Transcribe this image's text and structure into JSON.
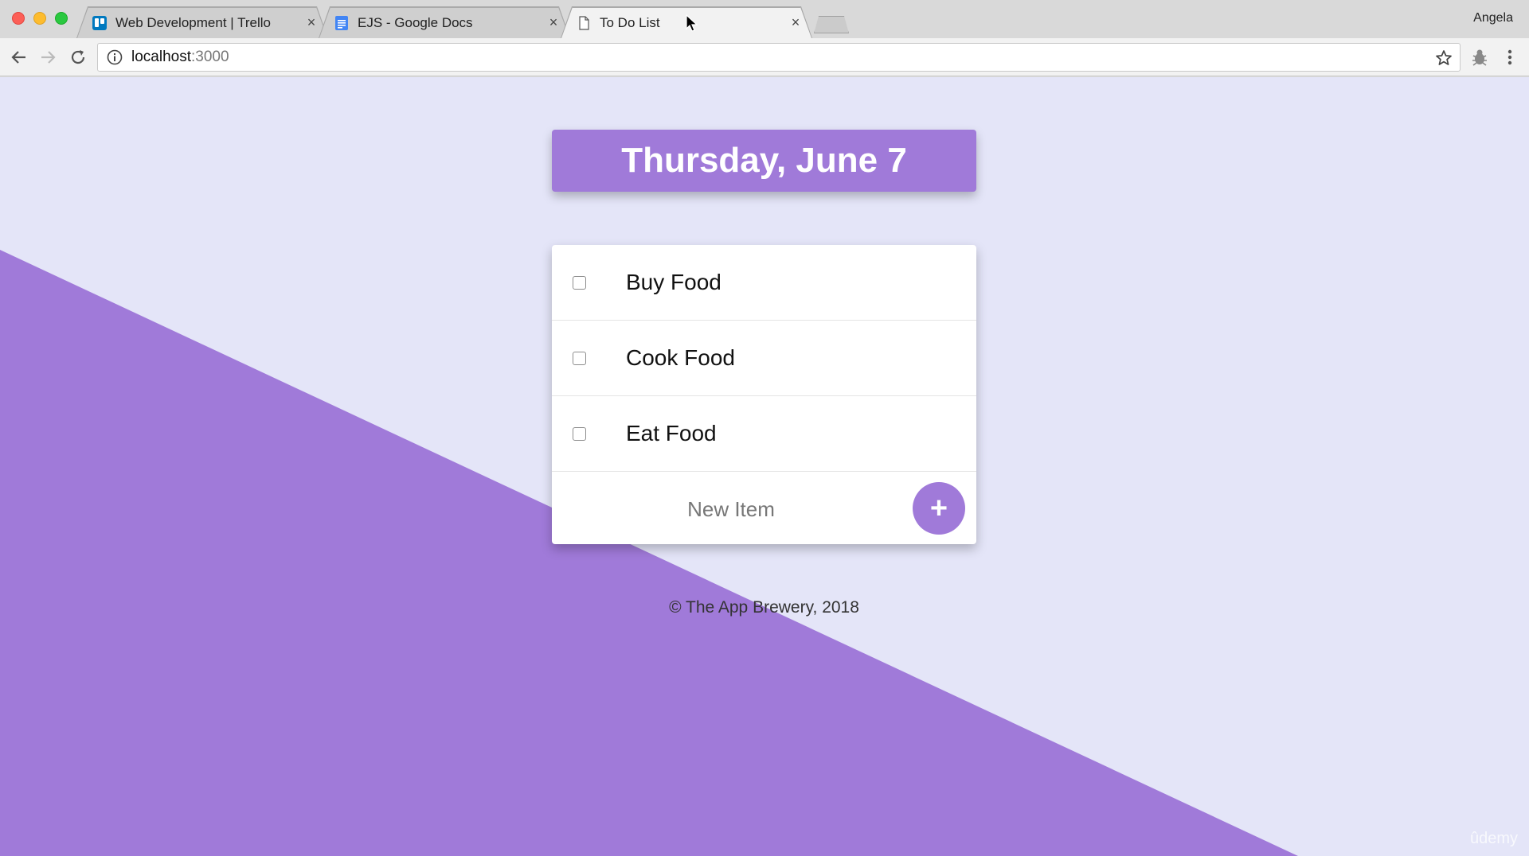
{
  "browser": {
    "tabs": [
      {
        "title": "Web Development | Trello",
        "icon": "trello-icon",
        "active": false
      },
      {
        "title": "EJS - Google Docs",
        "icon": "google-docs-icon",
        "active": false
      },
      {
        "title": "To Do List",
        "icon": "page-icon",
        "active": true
      }
    ],
    "tab_close": "×",
    "profile": "Angela",
    "url_host": "localhost",
    "url_port": ":3000"
  },
  "page": {
    "day_heading": "Thursday, June 7",
    "items": [
      {
        "label": "Buy Food",
        "checked": false
      },
      {
        "label": "Cook Food",
        "checked": false
      },
      {
        "label": "Eat Food",
        "checked": false
      }
    ],
    "new_item_placeholder": "New Item",
    "add_button": "+",
    "footer": "© The App Brewery, 2018",
    "watermark": "ûdemy"
  },
  "colors": {
    "accent": "#a07ad9",
    "background": "#e4e5f8"
  }
}
